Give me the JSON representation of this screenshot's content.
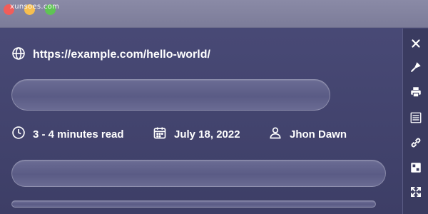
{
  "window": {
    "watermark": "xunsoes.com",
    "traffic_lights": [
      "close",
      "minimize",
      "maximize"
    ]
  },
  "article": {
    "url": "https://example.com/hello-world/",
    "url_icon": "globe-icon",
    "read_time": "3 - 4 minutes read",
    "read_time_icon": "clock-icon",
    "date": "July 18, 2022",
    "date_icon": "calendar-icon",
    "author": "Jhon Dawn",
    "author_icon": "user-icon"
  },
  "toolbar": {
    "tools": [
      {
        "name": "close",
        "icon": "close-icon"
      },
      {
        "name": "pen",
        "icon": "pen-icon"
      },
      {
        "name": "print",
        "icon": "printer-icon"
      },
      {
        "name": "list",
        "icon": "list-icon"
      },
      {
        "name": "link",
        "icon": "link-icon"
      },
      {
        "name": "image",
        "icon": "image-icon"
      },
      {
        "name": "fullscreen",
        "icon": "fullscreen-icon"
      }
    ]
  },
  "colors": {
    "background": "#3f4068",
    "titlebar": "#8585a2",
    "accent_text": "#ffffff",
    "skeleton": "#5e5f88"
  }
}
